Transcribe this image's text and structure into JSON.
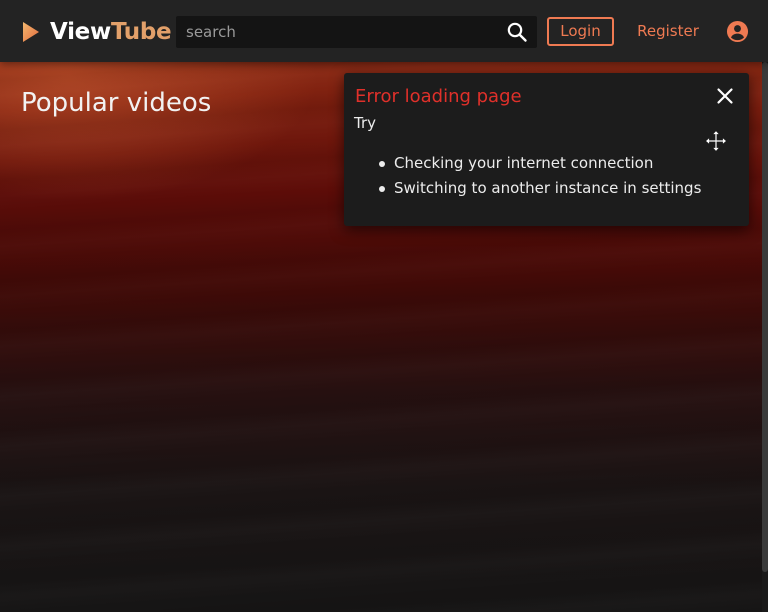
{
  "header": {
    "logo": {
      "text_view": "View",
      "text_tube": "Tube",
      "icon": "play-triangle-icon"
    },
    "search": {
      "placeholder": "search",
      "value": "",
      "icon": "search-icon"
    },
    "login_label": "Login",
    "register_label": "Register",
    "account_icon": "account-circle-icon"
  },
  "main": {
    "title": "Popular videos"
  },
  "error_toast": {
    "title": "Error loading page",
    "intro": "Try",
    "suggestions": [
      "Checking your internet connection",
      "Switching to another instance in settings"
    ],
    "close_icon": "close-icon",
    "drag_icon": "move-icon"
  },
  "colors": {
    "accent": "#ef7a52",
    "error": "#e0302a",
    "header_bg": "#232323",
    "toast_bg": "#1c1c1c",
    "logo_tube": "#e2a06a"
  }
}
